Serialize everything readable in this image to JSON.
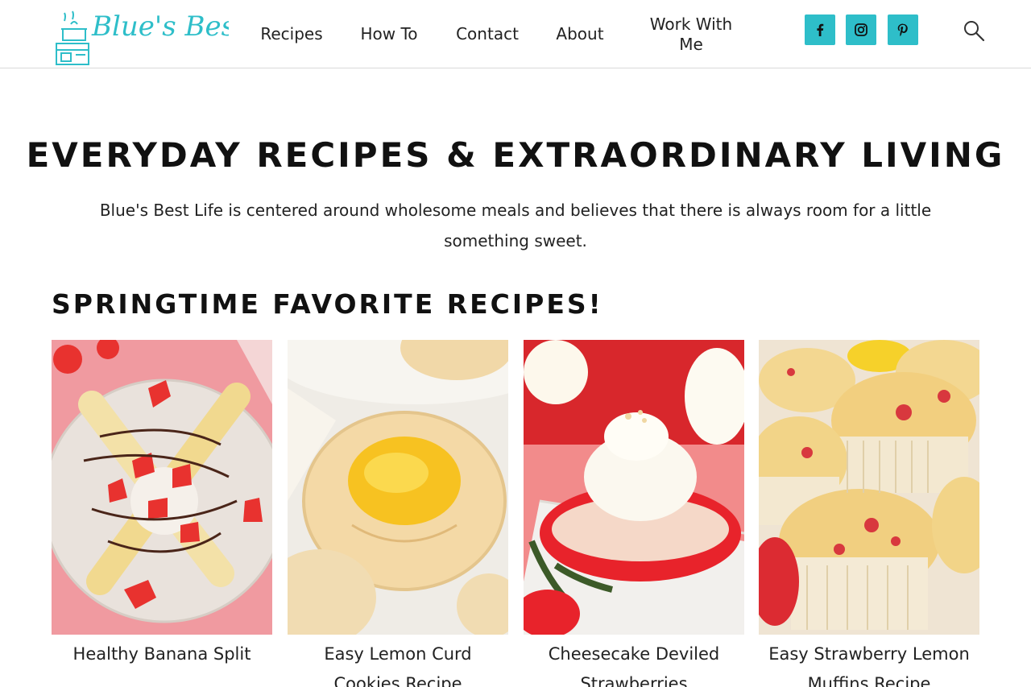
{
  "header": {
    "logo_text": "Blue's Best Life",
    "nav": [
      {
        "label": "Recipes"
      },
      {
        "label": "How To"
      },
      {
        "label": "Contact"
      },
      {
        "label": "About"
      },
      {
        "label": "Work With Me"
      }
    ],
    "social": [
      {
        "icon": "facebook-icon",
        "label": "f"
      },
      {
        "icon": "instagram-icon"
      },
      {
        "icon": "pinterest-icon"
      }
    ],
    "search_icon": "search-icon"
  },
  "hero": {
    "title": "EVERYDAY RECIPES & EXTRAORDINARY LIVING",
    "text": "Blue's Best Life is centered around wholesome meals and believes that there is always room for a little something sweet."
  },
  "section": {
    "title": "SPRINGTIME FAVORITE RECIPES!"
  },
  "cards": [
    {
      "title": "Healthy Banana Split"
    },
    {
      "title": "Easy Lemon Curd Cookies Recipe"
    },
    {
      "title": "Cheesecake Deviled Strawberries"
    },
    {
      "title": "Easy Strawberry Lemon Muffins Recipe"
    }
  ],
  "colors": {
    "brand": "#2ebec9",
    "text": "#111111",
    "divider": "#d9d9d9"
  }
}
